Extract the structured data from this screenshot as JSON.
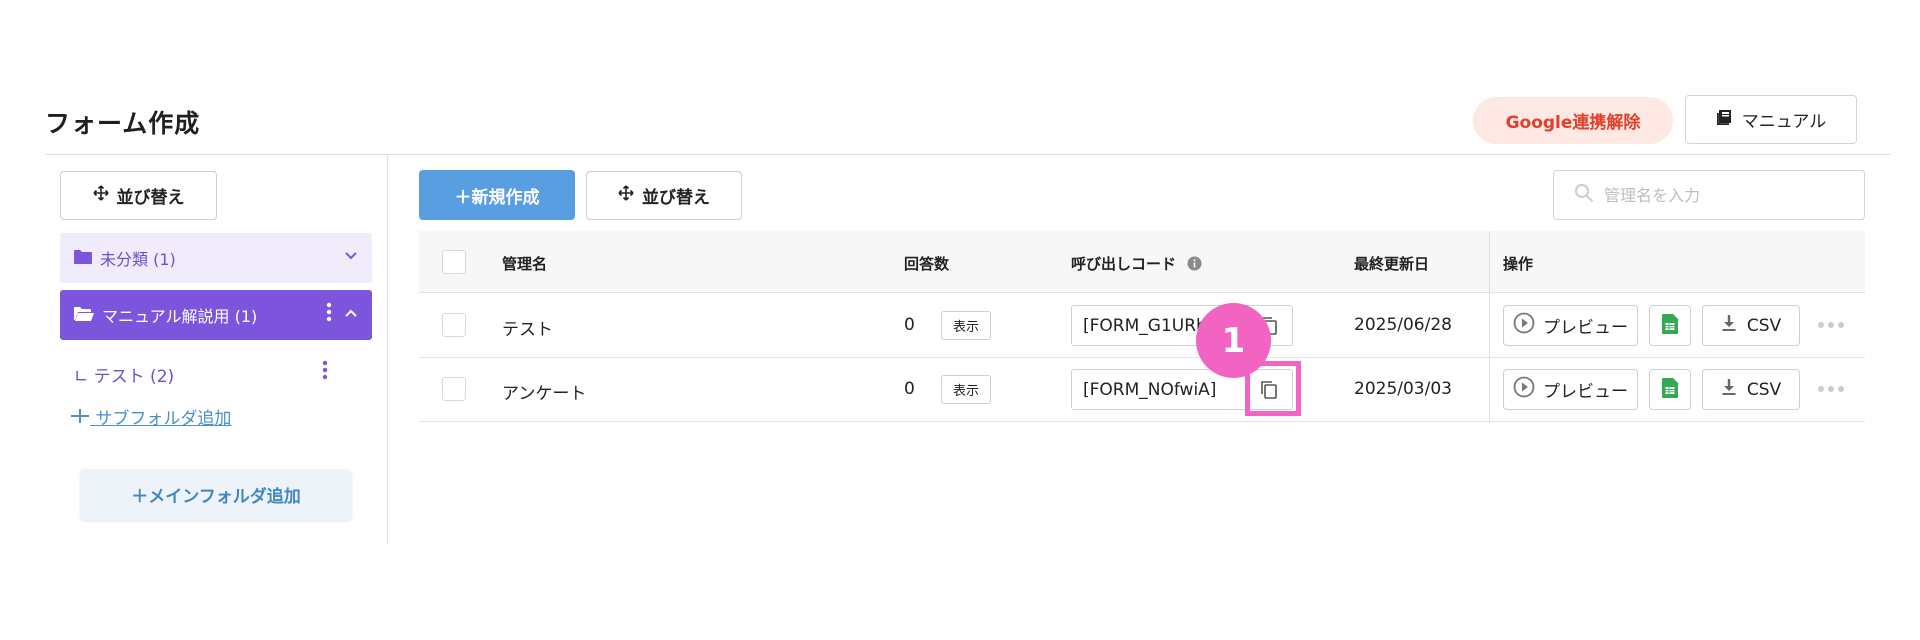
{
  "page": {
    "title": "フォーム作成",
    "google_unlink_label": "Google連携解除",
    "manual_label": "マニュアル"
  },
  "sidebar": {
    "sort_label": "並び替え",
    "folders": [
      {
        "label": "未分類 (1)"
      },
      {
        "label": "マニュアル解説用 (1)"
      }
    ],
    "subfolder": {
      "prefix": "∟",
      "label": "テスト (2)"
    },
    "add_subfolder_label": "サブフォルダ追加",
    "add_main_folder_label": "＋メインフォルダ追加"
  },
  "toolbar": {
    "new_label": "＋新規作成",
    "sort_label": "並び替え",
    "search_placeholder": "管理名を入力"
  },
  "table": {
    "headers": {
      "name": "管理名",
      "answers": "回答数",
      "code": "呼び出しコード",
      "updated": "最終更新日",
      "actions": "操作"
    },
    "rows": [
      {
        "name": "テスト",
        "answers": "0",
        "show_label": "表示",
        "code": "[FORM_G1URb",
        "updated": "2025/06/28",
        "preview_label": "プレビュー",
        "csv_label": "CSV"
      },
      {
        "name": "アンケート",
        "answers": "0",
        "show_label": "表示",
        "code": "[FORM_NOfwiA]",
        "updated": "2025/03/03",
        "preview_label": "プレビュー",
        "csv_label": "CSV"
      }
    ]
  },
  "annotation": {
    "number": "1",
    "color": "#f264c1"
  },
  "colors": {
    "accent_purple": "#7d55dc",
    "primary_blue": "#5a9ee2",
    "danger_red": "#e0412b",
    "sheet_green": "#34a853"
  },
  "icons": [
    "move-icon",
    "book-icon",
    "folder-icon",
    "folder-open-icon",
    "chevron-down-icon",
    "chevron-up-icon",
    "kebab-icon",
    "plus-icon",
    "search-icon",
    "info-icon",
    "copy-icon",
    "play-circle-icon",
    "spreadsheet-icon",
    "download-icon",
    "more-horizontal-icon"
  ]
}
